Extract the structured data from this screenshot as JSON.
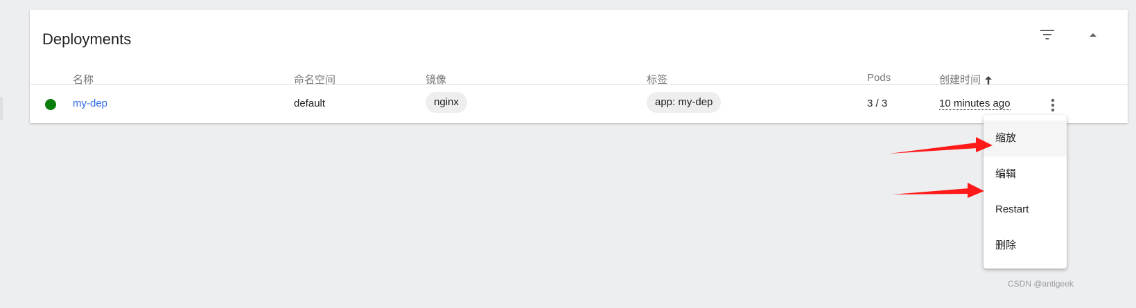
{
  "card": {
    "title": "Deployments",
    "filter_icon": "filter-icon",
    "collapse_icon": "caret-up-icon"
  },
  "table": {
    "columns": [
      "名称",
      "命名空间",
      "镜像",
      "标签",
      "Pods",
      "创建时间"
    ],
    "sort_icon": "arrow-up-icon",
    "rows": [
      {
        "status": "running",
        "status_color": "#0b7d0b",
        "name": "my-dep",
        "namespace": "default",
        "image": "nginx",
        "label": "app: my-dep",
        "pods": "3 / 3",
        "created": "10 minutes ago"
      }
    ]
  },
  "menu": {
    "items": [
      "缩放",
      "编辑",
      "Restart",
      "删除"
    ]
  },
  "colors": {
    "link": "#326de6",
    "annotation_arrow": "#ff1a1a"
  },
  "watermark": "CSDN @antigeek"
}
